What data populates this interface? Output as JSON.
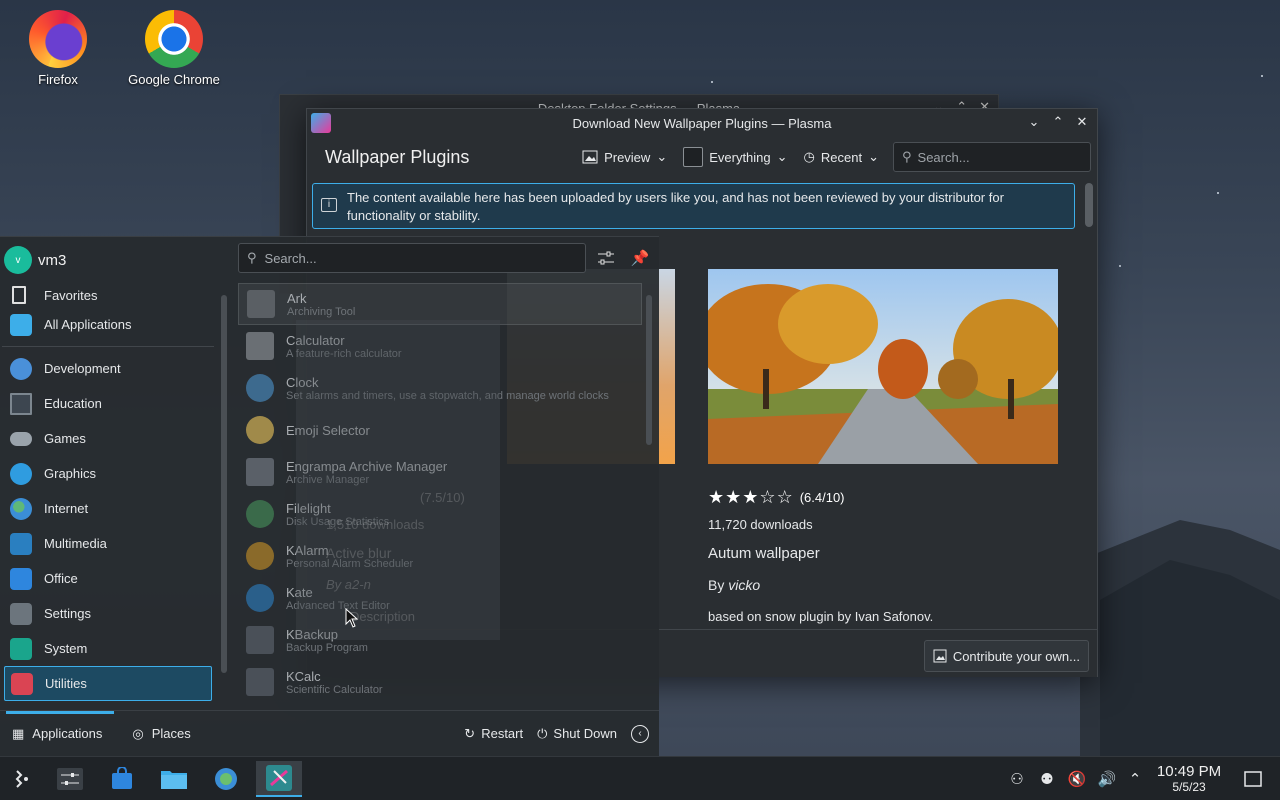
{
  "desktop": {
    "icons": [
      {
        "label": "Firefox"
      },
      {
        "label": "Google Chrome"
      }
    ]
  },
  "back_window": {
    "title": "Desktop Folder Settings — Plasma"
  },
  "dialog": {
    "title": "Download New Wallpaper Plugins — Plasma",
    "heading": "Wallpaper Plugins",
    "preview_label": "Preview",
    "filter_label": "Everything",
    "sort_label": "Recent",
    "search_placeholder": "Search...",
    "banner": "The content available here has been uploaded by users like you, and has not been reviewed by your distributor for functionality or stability.",
    "item": {
      "rating": "(6.4/10)",
      "rating_value": 6.4,
      "downloads": "11,720 downloads",
      "name": "Autum wallpaper",
      "by": "By",
      "author": "vicko",
      "description": "based on snow plugin by Ivan Safonov."
    },
    "contribute_label": "Contribute your own..."
  },
  "ghost": {
    "rating": "(7.5/10)",
    "downloads": "1,510 downloads",
    "name": "Active blur",
    "author": "By a2-n",
    "desc": "Description"
  },
  "launcher": {
    "user": "vm3",
    "avatar_letter": "v",
    "search_placeholder": "Search...",
    "categories": [
      {
        "label": "Favorites",
        "color": "#2a2e32"
      },
      {
        "label": "All Applications",
        "color": "#3daee9"
      },
      {
        "label": "Development",
        "color": "#4a90d9"
      },
      {
        "label": "Education",
        "color": "#5a6470"
      },
      {
        "label": "Games",
        "color": "#9aa3ab"
      },
      {
        "label": "Graphics",
        "color": "#2f9ce0"
      },
      {
        "label": "Internet",
        "color": "#3b8ed6"
      },
      {
        "label": "Multimedia",
        "color": "#2a7fc0"
      },
      {
        "label": "Office",
        "color": "#2e86de"
      },
      {
        "label": "Settings",
        "color": "#6c757d"
      },
      {
        "label": "System",
        "color": "#1aa58c"
      },
      {
        "label": "Utilities",
        "color": "#da4453"
      }
    ],
    "apps": [
      {
        "name": "Ark",
        "desc": "Archiving Tool"
      },
      {
        "name": "Calculator",
        "desc": "A feature-rich calculator"
      },
      {
        "name": "Clock",
        "desc": "Set alarms and timers, use a stopwatch, and manage world clocks"
      },
      {
        "name": "Emoji Selector",
        "desc": ""
      },
      {
        "name": "Engrampa Archive Manager",
        "desc": "Archive Manager"
      },
      {
        "name": "Filelight",
        "desc": "Disk Usage Statistics"
      },
      {
        "name": "KAlarm",
        "desc": "Personal Alarm Scheduler"
      },
      {
        "name": "Kate",
        "desc": "Advanced Text Editor"
      },
      {
        "name": "KBackup",
        "desc": "Backup Program"
      },
      {
        "name": "KCalc",
        "desc": "Scientific Calculator"
      }
    ],
    "footer": {
      "applications": "Applications",
      "places": "Places",
      "restart": "Restart",
      "shutdown": "Shut Down"
    }
  },
  "taskbar": {
    "time": "10:49 PM",
    "date": "5/5/23"
  },
  "colors": {
    "accent": "#3daee9",
    "panel": "#2a2e32",
    "selection": "#1d4a62"
  }
}
